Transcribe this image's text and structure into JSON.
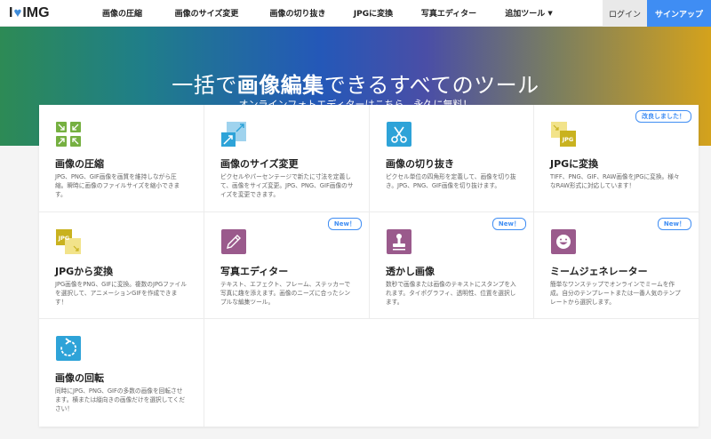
{
  "nav": {
    "logo_i": "I",
    "logo_img": "IMG",
    "items": [
      "画像の圧縮",
      "画像のサイズ変更",
      "画像の切り抜き",
      "JPGに変換",
      "写真エディター",
      "追加ツール"
    ],
    "login": "ログイン",
    "signup": "サインアップ"
  },
  "hero": {
    "title_a": "一括で",
    "title_b": "画像編集",
    "title_c": "できるすべてのツール",
    "subtitle": "オンラインフォトエディターはこちら。永久に無料！"
  },
  "tools": [
    {
      "title": "画像の圧縮",
      "desc": "JPG、PNG、GIF画像を画質を維持しながら圧縮。瞬時に画像のファイルサイズを縮小できます。",
      "badge": "",
      "icon": "compress-icon"
    },
    {
      "title": "画像のサイズ変更",
      "desc": "ピクセルやパーセンテージで新たに寸法を定義して、画像をサイズ変更。JPG、PNG、GIF画像のサイズを変更できます。",
      "badge": "",
      "icon": "resize-icon"
    },
    {
      "title": "画像の切り抜き",
      "desc": "ピクセル単位の四角形を定義して、画像を切り抜き。JPG、PNG、GIF画像を切り抜けます。",
      "badge": "",
      "icon": "scissors-icon"
    },
    {
      "title": "JPGに変換",
      "desc": "TIFF、PNG、GIF、RAW画像をJPGに変換。様々なRAW形式に対応しています！",
      "badge": "改良しました！",
      "icon": "convert-to-jpg-icon"
    },
    {
      "title": "JPGから変換",
      "desc": "JPG画像をPNG、GIFに変換。複数のJPGファイルを選択して、アニメーションGIFを作成できます！",
      "badge": "",
      "icon": "convert-from-jpg-icon"
    },
    {
      "title": "写真エディター",
      "desc": "テキスト、エフェクト、フレーム、ステッカーで写真に趣を添えます。画像のニーズに合ったシンプルな編集ツール。",
      "badge": "New！",
      "icon": "pencil-icon"
    },
    {
      "title": "透かし画像",
      "desc": "数秒で画像または画像のテキストにスタンプを入れます。タイポグラフィ、透明性、位置を選択します。",
      "badge": "New！",
      "icon": "stamp-icon"
    },
    {
      "title": "ミームジェネレーター",
      "desc": "簡単なワンステップでオンラインでミームを作成。自分のテンプレートまたは一番人気のテンプレートから選択します。",
      "badge": "New！",
      "icon": "smiley-icon"
    },
    {
      "title": "画像の回転",
      "desc": "同時にJPG、PNG、GIFの多数の画像を回転させます。横または縦向きの画像だけを選択してください！",
      "badge": "",
      "icon": "rotate-icon"
    }
  ],
  "colors": {
    "green": "#76b041",
    "blue": "#3f8df3",
    "teal": "#2ea3d8",
    "yellow": "#c9b21f",
    "purple": "#9a5a8c",
    "hero_blue": "#2458b8"
  },
  "jpg_label": "JPG"
}
